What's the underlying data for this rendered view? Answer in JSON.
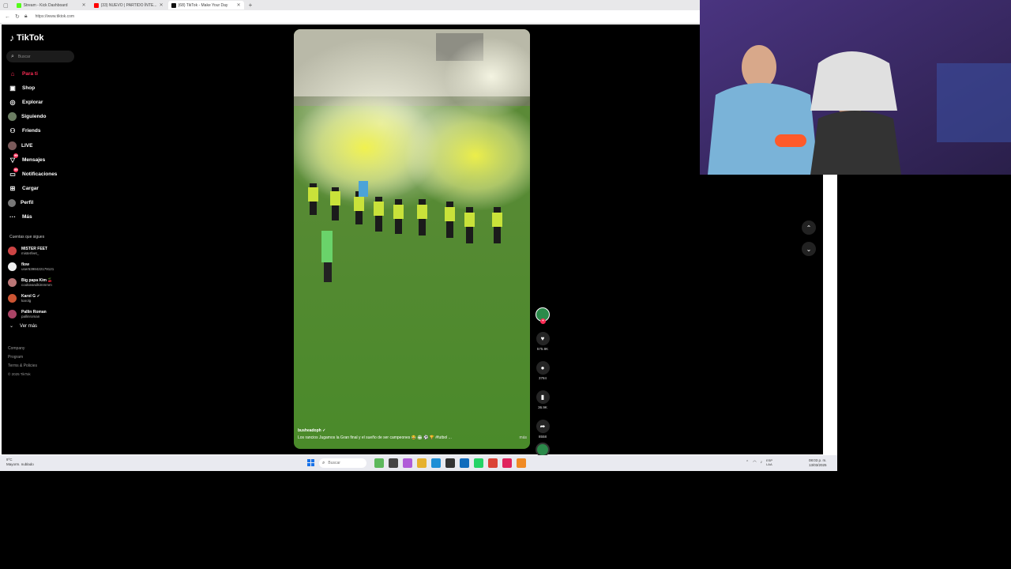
{
  "browser": {
    "tabs": [
      {
        "title": "Stream - Kick Dashboard",
        "fav_color": "#53fc18",
        "active": false
      },
      {
        "title": "(33) NUEVO | PARTIDO ÍNTE...",
        "fav_color": "#ff0000",
        "active": false
      },
      {
        "title": "(68) TikTok - Make Your Day",
        "fav_color": "#111111",
        "active": true
      }
    ],
    "new_tab": "+",
    "url": "https://www.tiktok.com"
  },
  "sidebar": {
    "logo": "TikTok",
    "search_placeholder": "Buscar",
    "nav": [
      {
        "label": "Para ti",
        "icon": "home-icon",
        "glyph": "⌂",
        "active": true
      },
      {
        "label": "Shop",
        "icon": "shop-icon",
        "glyph": "▣"
      },
      {
        "label": "Explorar",
        "icon": "compass-icon",
        "glyph": "◎"
      },
      {
        "label": "Siguiendo",
        "icon": "following-avatar-icon",
        "glyph": ""
      },
      {
        "label": "Friends",
        "icon": "friends-icon",
        "glyph": "⚇"
      },
      {
        "label": "LIVE",
        "icon": "live-icon",
        "glyph": ""
      },
      {
        "label": "Mensajes",
        "icon": "messages-icon",
        "glyph": "▽",
        "badge": "99"
      },
      {
        "label": "Notificaciones",
        "icon": "notifications-icon",
        "glyph": "▭",
        "badge": "99"
      },
      {
        "label": "Cargar",
        "icon": "upload-icon",
        "glyph": "⊞"
      },
      {
        "label": "Perfil",
        "icon": "profile-icon",
        "glyph": ""
      },
      {
        "label": "Más",
        "icon": "more-icon",
        "glyph": "···"
      }
    ],
    "following_title": "Cuentas que sigues",
    "accounts": [
      {
        "name": "MISTER FEET",
        "handle": "misterfeet_",
        "color": "#c44"
      },
      {
        "name": "flow",
        "handle": "user6398422179121",
        "color": "#eee"
      },
      {
        "name": "Big papa Kim 🍒",
        "handle": "cookieandkimmmm",
        "color": "#b77"
      },
      {
        "name": "Karol G ✓",
        "handle": "karolg",
        "color": "#c53"
      },
      {
        "name": "Pallin Roman",
        "handle": "pallinroman",
        "color": "#a46"
      }
    ],
    "see_more": "Ver más",
    "footer": [
      "Company",
      "Program",
      "Terms & Policies"
    ],
    "copyright": "© 2025 TikTok"
  },
  "video": {
    "author": "busheadoph ✓",
    "description": "Los rancios Jugamos la Gran final y el sueño de ser campeones 😂 🏟 ⚽ 🏆 #futbol ...",
    "more": "más"
  },
  "actions": {
    "likes": "575.9K",
    "comments": "3784",
    "saves": "36.9K",
    "shares": "8558"
  },
  "taskbar": {
    "weather_temp": "9°C",
    "weather_desc": "Mayorm. nublado",
    "search_placeholder": "Buscar",
    "lang_line1": "ESP",
    "lang_line2": "LAA",
    "time": "08:03 p. m.",
    "date": "13/03/2025"
  }
}
